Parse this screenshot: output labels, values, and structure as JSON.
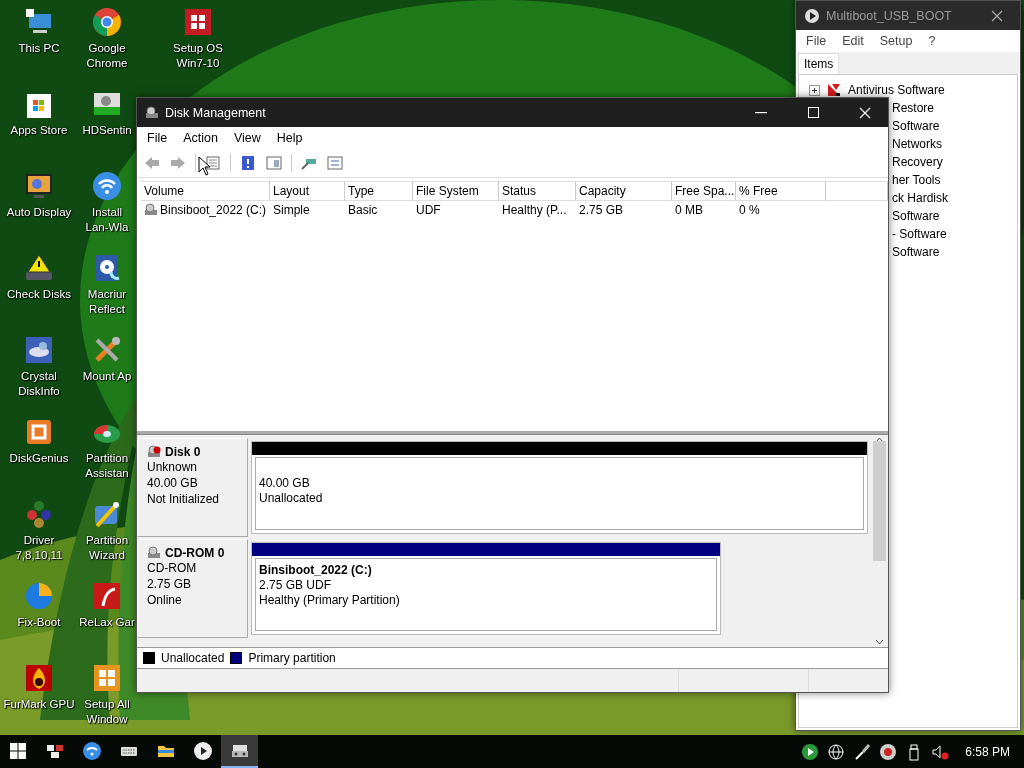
{
  "desktop_icons": [
    {
      "label": "This PC"
    },
    {
      "label": "Apps Store"
    },
    {
      "label": "Auto Display"
    },
    {
      "label": "Check Disks"
    },
    {
      "label": "Crystal DiskInfo"
    },
    {
      "label": "DiskGenius"
    },
    {
      "label": "Driver 7,8,10,11"
    },
    {
      "label": "Fix-Boot"
    },
    {
      "label": "FurMark GPU"
    },
    {
      "label": "Google Chrome"
    },
    {
      "label": "HDSentin"
    },
    {
      "label": "Install Lan-Wla"
    },
    {
      "label": "Macriur Reflect"
    },
    {
      "label": "Mount Ap"
    },
    {
      "label": "Partition Assistan"
    },
    {
      "label": "Partition Wizard"
    },
    {
      "label": "ReLax Gar"
    },
    {
      "label": "Setup All Window"
    },
    {
      "label": "Setup OS Win7-10"
    }
  ],
  "multiboot_window": {
    "title": "Multiboot_USB_BOOT",
    "menu": [
      "File",
      "Edit",
      "Setup",
      "?"
    ],
    "tab": "Items",
    "tree": [
      {
        "kind": "full",
        "label": "Antivirus Software",
        "expanded": false
      },
      {
        "kind": "partial",
        "label": "Restore"
      },
      {
        "kind": "partial",
        "label": "Software"
      },
      {
        "kind": "partial",
        "label": "Networks"
      },
      {
        "kind": "partial",
        "label": "Recovery"
      },
      {
        "kind": "partial",
        "label": "her Tools"
      },
      {
        "kind": "partial",
        "label": "ck Hardisk"
      },
      {
        "kind": "partial",
        "label": "Software"
      },
      {
        "kind": "partial",
        "label": "- Software"
      },
      {
        "kind": "partial",
        "label": "Software"
      }
    ]
  },
  "disk_window": {
    "title": "Disk Management",
    "menu": [
      "File",
      "Action",
      "View",
      "Help"
    ],
    "table": {
      "columns": [
        "Volume",
        "Layout",
        "Type",
        "File System",
        "Status",
        "Capacity",
        "Free Spa...",
        "% Free"
      ],
      "rows": [
        [
          "Binsiboot_2022 (C:)",
          "Simple",
          "Basic",
          "UDF",
          "Healthy (P...",
          "2.75 GB",
          "0 MB",
          "0 %"
        ]
      ]
    },
    "disks": [
      {
        "kind": "hdd",
        "name": "Disk 0",
        "lines": [
          "Unknown",
          "40.00 GB",
          "Not Initialized"
        ],
        "partitions": [
          {
            "kind": "unallocated",
            "color": "#000000",
            "lines": [
              "40.00 GB",
              "Unallocated"
            ]
          }
        ]
      },
      {
        "kind": "cdrom",
        "name": "CD-ROM 0",
        "lines": [
          "CD-ROM",
          "2.75 GB",
          "Online"
        ],
        "partitions": [
          {
            "kind": "primary",
            "color": "#000080",
            "title": "Binsiboot_2022  (C:)",
            "lines": [
              "2.75 GB UDF",
              "Healthy (Primary Partition)"
            ]
          }
        ]
      }
    ],
    "legend": [
      {
        "label": "Unallocated",
        "color": "#000000"
      },
      {
        "label": "Primary partition",
        "color": "#000080"
      }
    ]
  },
  "taskbar": {
    "time": "6:58 PM",
    "apps": [
      {
        "selected": false
      },
      {
        "selected": false
      },
      {
        "selected": false
      },
      {
        "selected": false
      },
      {
        "selected": false
      },
      {
        "selected": true
      }
    ]
  }
}
